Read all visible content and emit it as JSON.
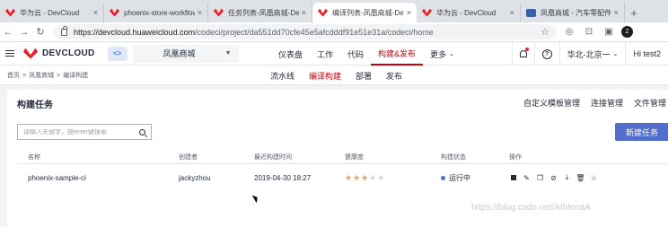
{
  "browser": {
    "tabs": [
      {
        "title": "华为云 - DevCloud",
        "icon": "huawei-icon"
      },
      {
        "title": "phoenix-store-workflow",
        "icon": "huawei-icon"
      },
      {
        "title": "任务列表-凤凰商城-Dev",
        "icon": "huawei-icon"
      },
      {
        "title": "编译列表-凤凰商城-Dev",
        "icon": "huawei-icon",
        "active": true
      },
      {
        "title": "华为云 - DevCloud",
        "icon": "huawei-icon"
      },
      {
        "title": "凤凰商城 - 汽车零配件网",
        "icon": "car-icon"
      }
    ],
    "url_host": "https://devcloud.huaweicloud.com",
    "url_path": "/codeci/project/da551dd70cfe45e5afcdddf91e51e31a/codeci/home",
    "profile_label": "Z"
  },
  "header": {
    "logo_text": "DEVCLOUD",
    "service_icon_text": "<>",
    "project": "凤凰商城",
    "nav": [
      "仪表盘",
      "工作",
      "代码",
      "构建&发布",
      "更多"
    ],
    "active_nav_index": 3,
    "region": "华北-北京一",
    "user": "Hi test2"
  },
  "subnav": {
    "breadcrumb": [
      "首页",
      "凤凰商城",
      "编译构建"
    ],
    "tabs": [
      "流水线",
      "编译构建",
      "部署",
      "发布"
    ],
    "active_tab_index": 1
  },
  "card": {
    "title": "构建任务",
    "links": [
      "自定义模板管理",
      "连接管理",
      "文件管理"
    ],
    "search_placeholder": "请输入关键字，按enter键搜索",
    "new_button": "新建任务",
    "columns": [
      "名称",
      "创建者",
      "最近构建时间",
      "健康度",
      "构建状态",
      "操作"
    ],
    "rows": [
      {
        "name": "phoenix-sample-ci",
        "creator": "jackyzhou",
        "last_build": "2019-04-30 18:27",
        "health_stars": 3,
        "health_max": 5,
        "status": "运行中"
      }
    ]
  },
  "watermark": "https://blog.csdn.net/AthlenaA"
}
